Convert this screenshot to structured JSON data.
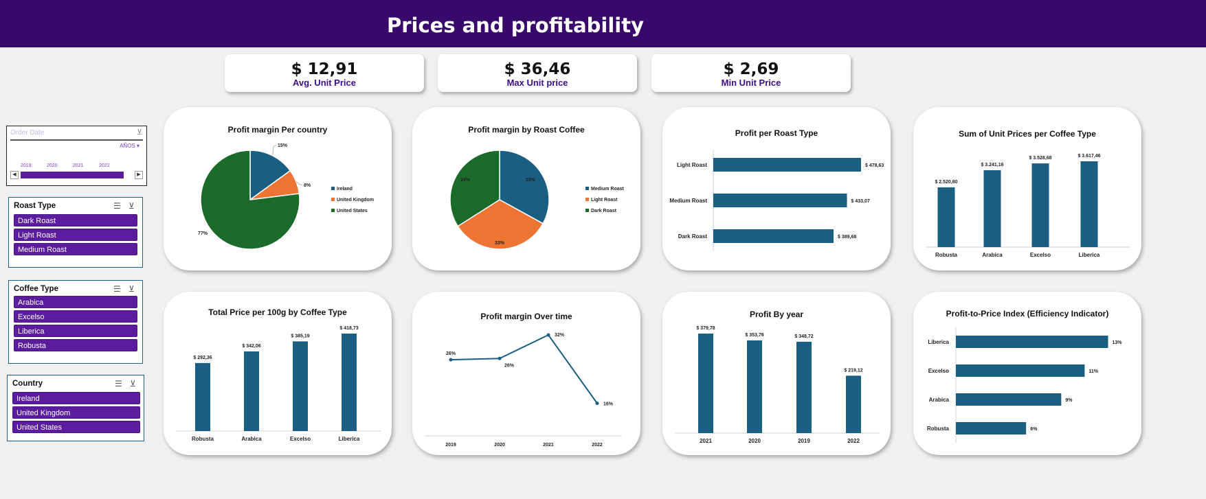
{
  "header": {
    "title": "Prices and profitability"
  },
  "kpis": [
    {
      "value": "$ 12,91",
      "label": "Avg. Unit Price"
    },
    {
      "value": "$ 36,46",
      "label": "Max Unit price"
    },
    {
      "value": "$ 2,69",
      "label": "Min Unit Price"
    }
  ],
  "timeline": {
    "title": "Order Date",
    "level": "AÑOS",
    "years": [
      "2019",
      "2020",
      "2021",
      "2022"
    ]
  },
  "slicers": {
    "roast": {
      "title": "Roast Type",
      "items": [
        "Dark Roast",
        "Light Roast",
        "Medium Roast"
      ]
    },
    "coffee": {
      "title": "Coffee Type",
      "items": [
        "Arabica",
        "Excelso",
        "Liberica",
        "Robusta"
      ]
    },
    "country": {
      "title": "Country",
      "items": [
        "Ireland",
        "United Kingdom",
        "United States"
      ]
    }
  },
  "colors": {
    "header": "#38096a",
    "bar": "#1a5e82",
    "green": "#1a6b2a",
    "orange": "#ed7432",
    "blue": "#1a5e82",
    "slicer_item": "#5b1c9e",
    "kpi_label": "#3a0d86"
  },
  "chart_data": [
    {
      "id": "profit-margin-country",
      "type": "pie",
      "title": "Profit margin Per country",
      "categories": [
        "Ireland",
        "United Kingdom",
        "United States"
      ],
      "values": [
        15,
        8,
        77
      ],
      "data_labels": [
        "15%",
        "8%",
        "77%"
      ],
      "legend": "right"
    },
    {
      "id": "profit-margin-roast",
      "type": "pie",
      "title": "Profit margin by Roast Coffee",
      "categories": [
        "Medium Roast",
        "Light Roast",
        "Dark Roast"
      ],
      "values": [
        33,
        33,
        34
      ],
      "data_labels": [
        "33%",
        "33%",
        "34%"
      ],
      "legend": "right"
    },
    {
      "id": "profit-roast-type",
      "type": "bar",
      "orientation": "horizontal",
      "title": "Profit per  Roast Type",
      "categories": [
        "Light Roast",
        "Medium Roast",
        "Dark Roast"
      ],
      "values": [
        478.63,
        433.07,
        389.68
      ],
      "data_labels": [
        "$ 478,63",
        "$ 433,07",
        "$ 389,68"
      ],
      "xlim": [
        0,
        500
      ]
    },
    {
      "id": "sum-unit-price",
      "type": "bar",
      "title": "Sum of Unit Prices per Coffee Type",
      "categories": [
        "Robusta",
        "Arabica",
        "Excelso",
        "Liberica"
      ],
      "values": [
        2520.8,
        3241.16,
        3528.68,
        3617.46
      ],
      "data_labels": [
        "$ 2.520,80",
        "$ 3.241,16",
        "$ 3.528,68",
        "$ 3.617,46"
      ],
      "ylim": [
        0,
        4000
      ]
    },
    {
      "id": "total-price-100g",
      "type": "bar",
      "title": "Total Price per 100g by Coffee Type",
      "categories": [
        "Robusta",
        "Arabica",
        "Excelso",
        "Liberica"
      ],
      "values": [
        292.36,
        342.06,
        385.19,
        418.73
      ],
      "data_labels": [
        "$ 292,36",
        "$ 342,06",
        "$ 385,19",
        "$ 418,73"
      ],
      "ylim": [
        0,
        450
      ]
    },
    {
      "id": "profit-margin-time",
      "type": "line",
      "title": "Profit margin Over  time",
      "categories": [
        "2019",
        "2020",
        "2021",
        "2022"
      ],
      "values": [
        26.2,
        26.5,
        32,
        16
      ],
      "data_labels": [
        "26%",
        "26%",
        "32%",
        "16%"
      ],
      "ylim": [
        0,
        35
      ]
    },
    {
      "id": "profit-by-year",
      "type": "bar",
      "title": "Profit By year",
      "categories": [
        "2021",
        "2020",
        "2019",
        "2022"
      ],
      "values": [
        379.78,
        353.76,
        348.72,
        219.12
      ],
      "data_labels": [
        "$ 379,78",
        "$ 353,76",
        "$ 348,72",
        "$ 219,12"
      ],
      "ylim": [
        0,
        400
      ]
    },
    {
      "id": "profit-price-index",
      "type": "bar",
      "orientation": "horizontal",
      "title": "Profit-to-Price Index (Efficiency Indicator)",
      "categories": [
        "Liberica",
        "Excelso",
        "Arabica",
        "Robusta"
      ],
      "values": [
        13,
        11,
        9,
        6
      ],
      "data_labels": [
        "13%",
        "11%",
        "9%",
        "6%"
      ],
      "xlim": [
        0,
        15
      ]
    }
  ]
}
